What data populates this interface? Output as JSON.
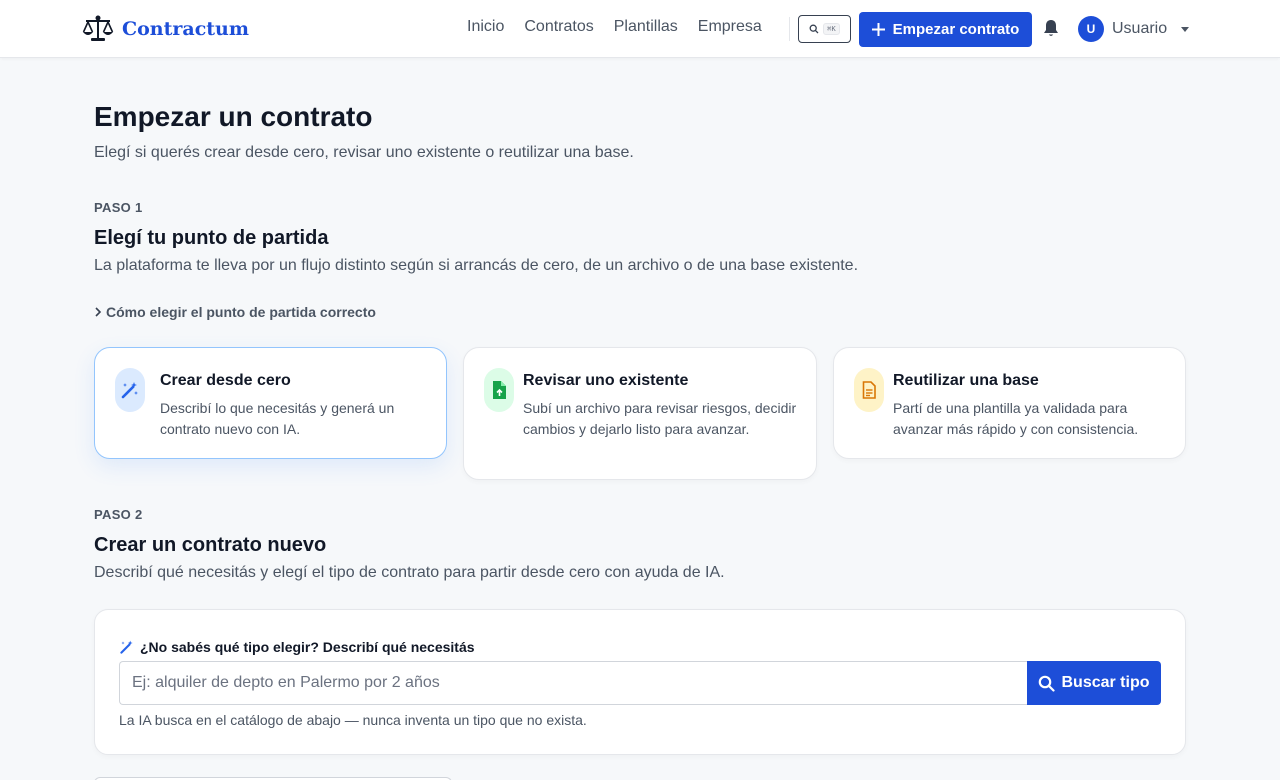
{
  "header": {
    "brand": "Contractum",
    "nav": [
      "Inicio",
      "Contratos",
      "Plantillas",
      "Empresa"
    ],
    "search_shortcut": "⌘K",
    "cta_label": "Empezar contrato",
    "user_initial": "U",
    "user_name": "Usuario"
  },
  "page": {
    "title": "Empezar un contrato",
    "subtitle": "Elegí si querés crear desde cero, revisar uno existente o reutilizar una base."
  },
  "step1": {
    "label": "PASO 1",
    "title": "Elegí tu punto de partida",
    "description": "La plataforma te lleva por un flujo distinto según si arrancás de cero, de un archivo o de una base existente.",
    "disclosure": "Cómo elegir el punto de partida correcto",
    "options": [
      {
        "title": "Crear desde cero",
        "description": "Describí lo que necesitás y generá un contrato nuevo con IA.",
        "icon": "magic-wand-icon",
        "accent": "#2563eb",
        "selected": true
      },
      {
        "title": "Revisar uno existente",
        "description": "Subí un archivo para revisar riesgos, decidir cambios y dejarlo listo para avanzar.",
        "icon": "file-upload-icon",
        "accent": "#16a34a",
        "selected": false
      },
      {
        "title": "Reutilizar una base",
        "description": "Partí de una plantilla ya validada para avanzar más rápido y con consistencia.",
        "icon": "document-icon",
        "accent": "#d97706",
        "selected": false
      }
    ]
  },
  "step2": {
    "label": "PASO 2",
    "title": "Crear un contrato nuevo",
    "description": "Describí qué necesitás y elegí el tipo de contrato para partir desde cero con ayuda de IA.",
    "search": {
      "label": "¿No sabés qué tipo elegir? Describí qué necesitás",
      "placeholder": "Ej: alquiler de depto en Palermo por 2 años",
      "value": "",
      "button_label": "Buscar tipo",
      "hint": "La IA busca en el catálogo de abajo — nunca inventa un tipo que no exista."
    }
  },
  "colors": {
    "primary": "#1d4ed8",
    "page_bg": "#f6f8fa",
    "text": "#111827",
    "muted": "#4b5563"
  }
}
